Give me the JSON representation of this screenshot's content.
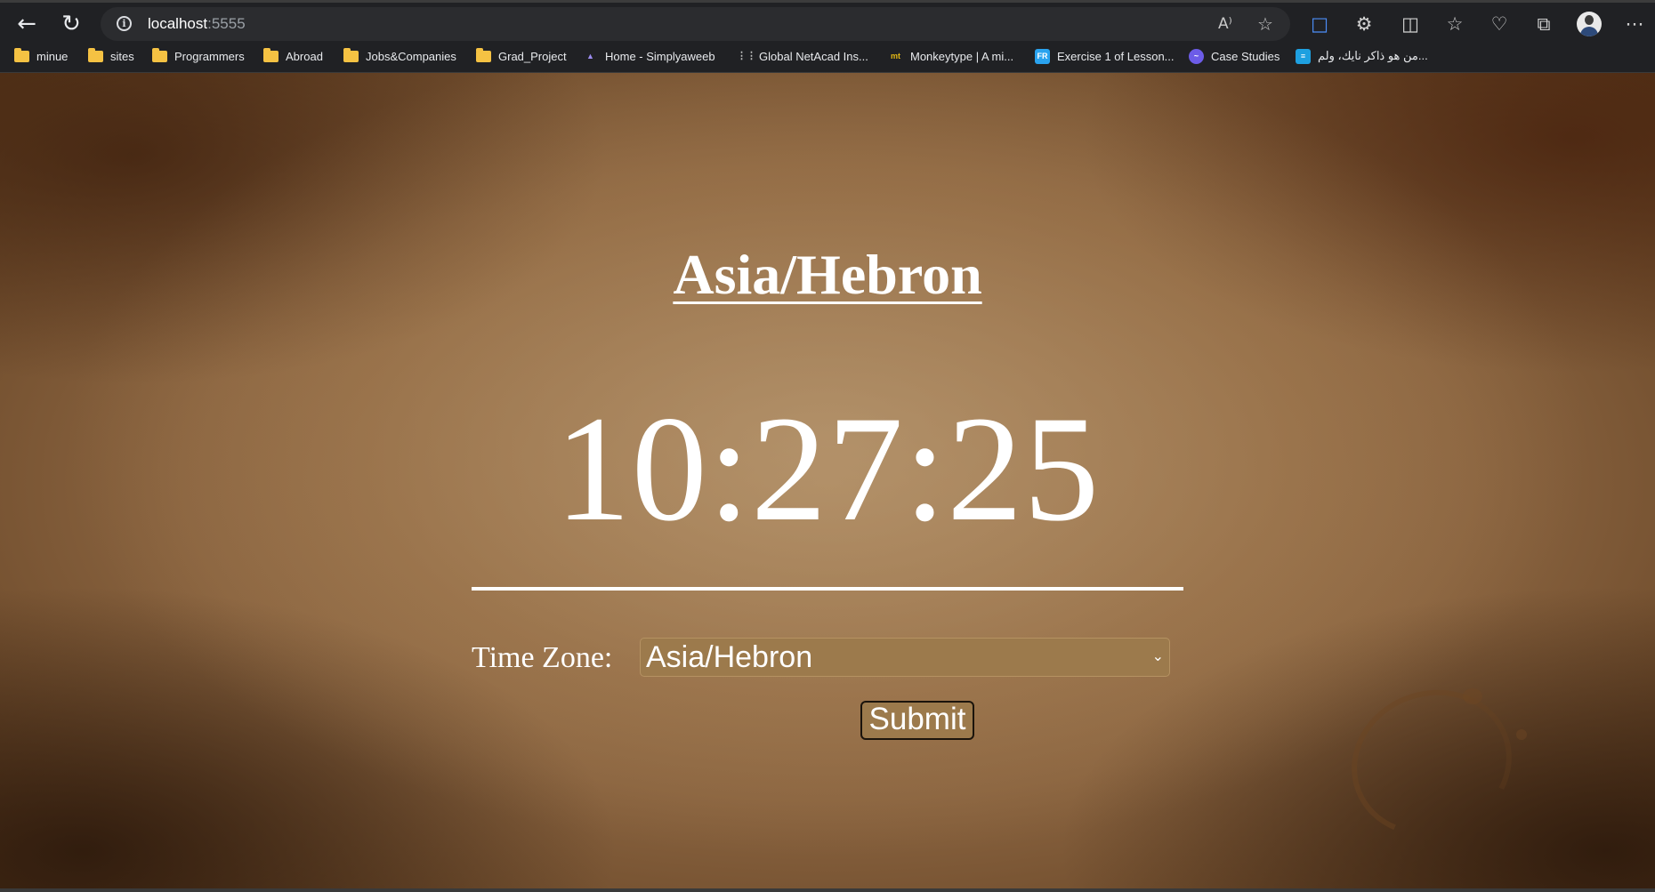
{
  "browser": {
    "url_host": "localhost",
    "url_port": ":5555",
    "read_aloud_glyph": "A⁾",
    "bookmarks": [
      {
        "label": "minue",
        "icon": "folder-icon"
      },
      {
        "label": "sites",
        "icon": "folder-icon"
      },
      {
        "label": "Programmers",
        "icon": "folder-icon"
      },
      {
        "label": "Abroad",
        "icon": "folder-icon"
      },
      {
        "label": "Jobs&Companies",
        "icon": "folder-icon"
      },
      {
        "label": "Grad_Project",
        "icon": "folder-icon"
      },
      {
        "label": "Home - Simplyaweeb",
        "icon": "simplyaweeb-icon"
      },
      {
        "label": "Global NetAcad Ins...",
        "icon": "cisco-icon"
      },
      {
        "label": "Monkeytype | A mi...",
        "icon": "monkeytype-icon",
        "icon_text": "mt"
      },
      {
        "label": "Exercise 1 of Lesson...",
        "icon": "fr-icon",
        "icon_text": "FR"
      },
      {
        "label": "Case Studies",
        "icon": "case-studies-icon"
      },
      {
        "label": "من هو ذاكر نايك، ولم...",
        "icon": "arabic-site-icon"
      }
    ]
  },
  "page": {
    "heading": "Asia/Hebron",
    "clock": "10:27:25",
    "timezone_label": "Time Zone:",
    "timezone_selected": "Asia/Hebron",
    "submit_label": "Submit"
  },
  "colors": {
    "accent_button": "#9c7a4c",
    "text": "#ffffff",
    "background": "#8a6440"
  }
}
